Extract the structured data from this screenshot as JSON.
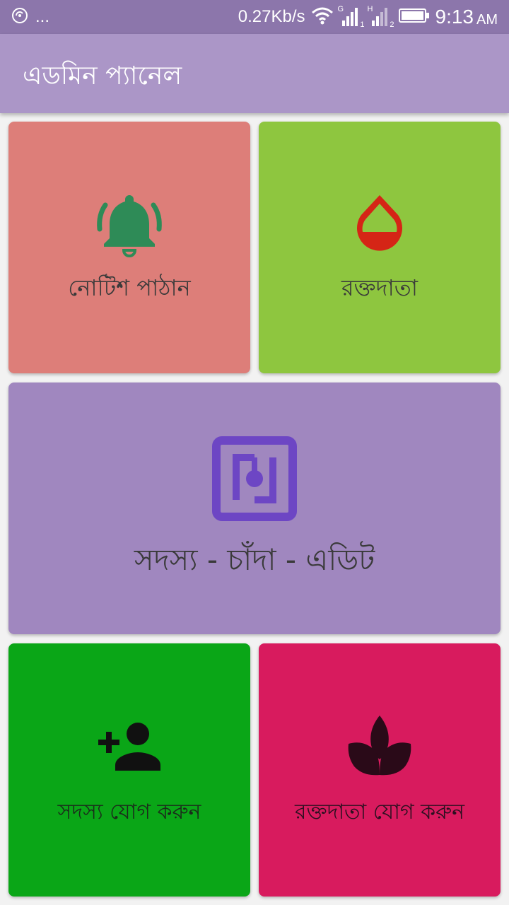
{
  "status_bar": {
    "network_speed": "0.27Kb/s",
    "ellipsis": "...",
    "time": "9:13",
    "ampm": "AM",
    "sim1_label": "G",
    "sim1_index": "1",
    "sim2_label": "H",
    "sim2_index": "2",
    "icons": [
      "sync-icon",
      "wifi-icon",
      "signal-icon",
      "battery-icon"
    ]
  },
  "app_bar": {
    "title": "এডমিন প্যানেল"
  },
  "cards": {
    "notice": {
      "label": "নোটিশ পাঠান",
      "icon": "bell-ringing-icon",
      "color": "#dd7e79"
    },
    "donor": {
      "label": "রক্তদাতা",
      "icon": "blood-drop-icon",
      "color": "#8ec63f"
    },
    "member_fee_edit": {
      "label": "সদস্য - চাঁদা - এডিট",
      "icon": "nfc-icon",
      "color": "#a087bf"
    },
    "add_member": {
      "label": "সদস্য যোগ করুন",
      "icon": "person-add-icon",
      "color": "#0aa617"
    },
    "add_donor": {
      "label": "রক্তদাতা যোগ করুন",
      "icon": "lotus-icon",
      "color": "#d81b5e"
    }
  },
  "colors": {
    "status_bar": "#8c76ab",
    "app_bar": "#ab96c7",
    "bell_icon": "#2e8b57",
    "drop_icon": "#d52516",
    "nfc_icon": "#6d46c4"
  }
}
